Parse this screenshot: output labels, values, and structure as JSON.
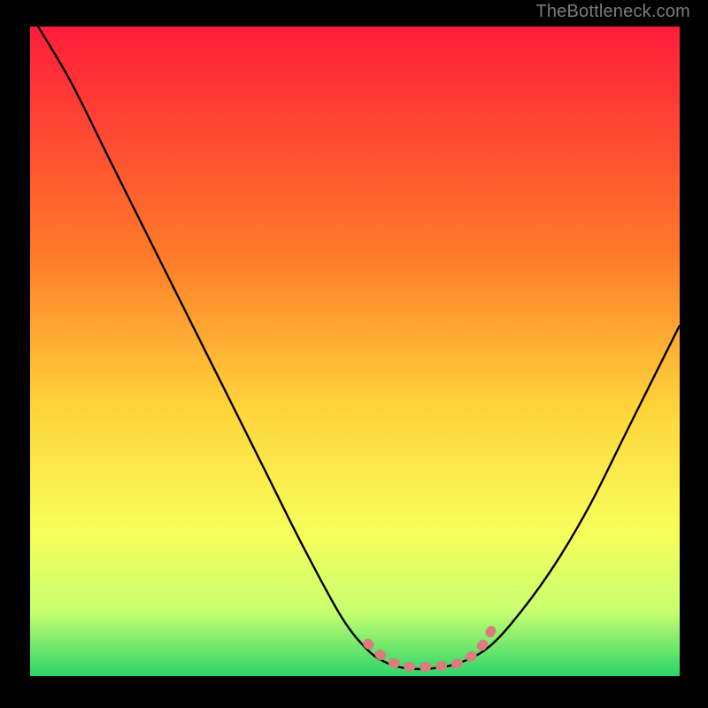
{
  "watermark": "TheBottleneck.com",
  "colors": {
    "bg_black": "#000000",
    "grad_top": "#ff1d3a",
    "grad_mid1": "#ff7a2a",
    "grad_mid2": "#ffd23a",
    "grad_mid3": "#f7ff5a",
    "grad_low": "#c8ff70",
    "grad_bottom": "#2bd46a",
    "curve": "#000000",
    "highlight": "#d97d7d"
  },
  "chart_data": {
    "type": "line",
    "title": "",
    "xlabel": "",
    "ylabel": "",
    "xlim": [
      0,
      100
    ],
    "ylim": [
      0,
      100
    ],
    "series": [
      {
        "name": "bottleneck-curve",
        "x": [
          0,
          6,
          12,
          18,
          24,
          30,
          36,
          42,
          48,
          52,
          55,
          58,
          62,
          66,
          70,
          74,
          80,
          86,
          92,
          100
        ],
        "y": [
          102,
          92,
          80,
          68,
          56,
          44,
          32,
          20,
          9,
          4,
          2,
          1.2,
          1.2,
          2,
          4,
          8,
          16,
          26,
          38,
          54
        ]
      },
      {
        "name": "sweet-spot-highlight",
        "x": [
          52,
          55,
          58,
          62,
          66,
          69,
          71
        ],
        "y": [
          5,
          2.5,
          1.5,
          1.5,
          2,
          4,
          7
        ]
      }
    ]
  }
}
